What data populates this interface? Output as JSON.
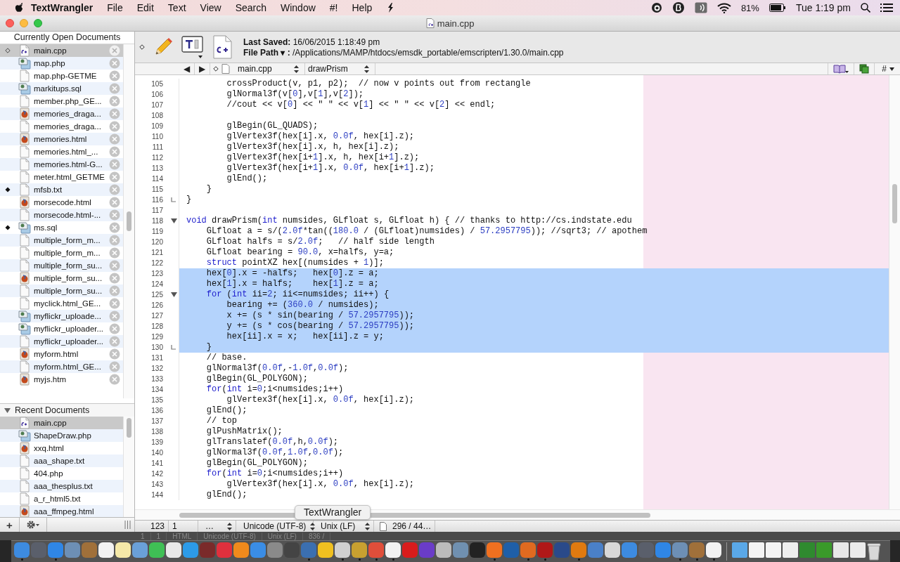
{
  "menu_bar": {
    "app_name": "TextWrangler",
    "menus": [
      "File",
      "Edit",
      "Text",
      "View",
      "Search",
      "Window",
      "#!",
      "Help"
    ],
    "battery": "81%",
    "clock": "Tue 1:19 pm"
  },
  "window": {
    "title": "main.cpp"
  },
  "sidebar": {
    "open_header": "Currently Open Documents",
    "open_documents": [
      {
        "name": "main.cpp",
        "kind": "cpp",
        "active": true,
        "modified": false,
        "selected": true
      },
      {
        "name": "map.php",
        "kind": "script",
        "active": false,
        "modified": false,
        "selected": false
      },
      {
        "name": "map.php-GETME",
        "kind": "blank",
        "active": false,
        "modified": false,
        "selected": false
      },
      {
        "name": "markitups.sql",
        "kind": "script",
        "active": false,
        "modified": false,
        "selected": false
      },
      {
        "name": "member.php_GE...",
        "kind": "blank",
        "active": false,
        "modified": false,
        "selected": false
      },
      {
        "name": "memories_draga...",
        "kind": "html",
        "active": false,
        "modified": false,
        "selected": false
      },
      {
        "name": "memories_draga...",
        "kind": "blank",
        "active": false,
        "modified": false,
        "selected": false
      },
      {
        "name": "memories.html",
        "kind": "html",
        "active": false,
        "modified": false,
        "selected": false
      },
      {
        "name": "memories.html_...",
        "kind": "blank",
        "active": false,
        "modified": false,
        "selected": false
      },
      {
        "name": "memories.html-G...",
        "kind": "blank",
        "active": false,
        "modified": false,
        "selected": false
      },
      {
        "name": "meter.html_GETME",
        "kind": "blank",
        "active": false,
        "modified": false,
        "selected": false
      },
      {
        "name": "mfsb.txt",
        "kind": "blank",
        "active": false,
        "modified": true,
        "selected": false
      },
      {
        "name": "morsecode.html",
        "kind": "html",
        "active": false,
        "modified": false,
        "selected": false
      },
      {
        "name": "morsecode.html-...",
        "kind": "blank",
        "active": false,
        "modified": false,
        "selected": false
      },
      {
        "name": "ms.sql",
        "kind": "script",
        "active": false,
        "modified": true,
        "selected": false
      },
      {
        "name": "multiple_form_m...",
        "kind": "blank",
        "active": false,
        "modified": false,
        "selected": false
      },
      {
        "name": "multiple_form_m...",
        "kind": "blank",
        "active": false,
        "modified": false,
        "selected": false
      },
      {
        "name": "multiple_form_su...",
        "kind": "blank",
        "active": false,
        "modified": false,
        "selected": false
      },
      {
        "name": "multiple_form_su...",
        "kind": "html",
        "active": false,
        "modified": false,
        "selected": false
      },
      {
        "name": "multiple_form_su...",
        "kind": "blank",
        "active": false,
        "modified": false,
        "selected": false
      },
      {
        "name": "myclick.html_GE...",
        "kind": "blank",
        "active": false,
        "modified": false,
        "selected": false
      },
      {
        "name": "myflickr_uploade...",
        "kind": "script",
        "active": false,
        "modified": false,
        "selected": false
      },
      {
        "name": "myflickr_uploader...",
        "kind": "script",
        "active": false,
        "modified": false,
        "selected": false
      },
      {
        "name": "myflickr_uploader...",
        "kind": "blank",
        "active": false,
        "modified": false,
        "selected": false
      },
      {
        "name": "myform.html",
        "kind": "html",
        "active": false,
        "modified": false,
        "selected": false
      },
      {
        "name": "myform.html_GE...",
        "kind": "blank",
        "active": false,
        "modified": false,
        "selected": false
      },
      {
        "name": "myjs.htm",
        "kind": "html",
        "active": false,
        "modified": false,
        "selected": false
      }
    ],
    "recent_header": "Recent Documents",
    "recent_expanded": true,
    "recent_documents": [
      {
        "name": "main.cpp",
        "kind": "cpp",
        "selected": true
      },
      {
        "name": "ShapeDraw.php",
        "kind": "script",
        "selected": false
      },
      {
        "name": "xxq.html",
        "kind": "html",
        "selected": false
      },
      {
        "name": "aaa_shape.txt",
        "kind": "blank",
        "selected": false
      },
      {
        "name": "404.php",
        "kind": "blank",
        "selected": false
      },
      {
        "name": "aaa_thesplus.txt",
        "kind": "blank",
        "selected": false
      },
      {
        "name": "a_r_html5.txt",
        "kind": "blank",
        "selected": false
      },
      {
        "name": "aaa_ffmpeg.html",
        "kind": "html",
        "selected": false
      }
    ],
    "add_button": "+"
  },
  "toolbar": {
    "last_saved_label": "Last Saved:",
    "last_saved": "16/06/2015 1:18:49 pm",
    "file_path_label": "File Path ▾ :",
    "file_path": "/Applications/MAMP/htdocs/emsdk_portable/emscripten/1.30.0/main.cpp"
  },
  "nav_bar": {
    "back": "◀",
    "forward": "▶",
    "document": "main.cpp",
    "function": "drawPrism",
    "counterpart": "#"
  },
  "editor": {
    "lines": [
      {
        "number": "105",
        "code": "        crossProduct(v, p1, p2);  // now v points out from rectangle",
        "kind": "plain",
        "selected": false
      },
      {
        "number": "106",
        "code": "        glNormal3f(v[0],v[1],v[2]);",
        "kind": "plain",
        "selected": false
      },
      {
        "number": "107",
        "code": "        //cout << v[0] << \" \" << v[1] << \" \" << v[2] << endl;",
        "kind": "plain",
        "selected": false
      },
      {
        "number": "108",
        "kind": "plain",
        "selected": false
      },
      {
        "number": "109",
        "code": "        glBegin(GL_QUADS);",
        "kind": "plain",
        "selected": false
      },
      {
        "number": "110",
        "code": "        glVertex3f(hex[i].x, 0.0f, hex[i].z);",
        "kind": "plain",
        "selected": false
      },
      {
        "number": "111",
        "code": "        glVertex3f(hex[i].x, h, hex[i].z);",
        "kind": "plain",
        "selected": false
      },
      {
        "number": "112",
        "code": "        glVertex3f(hex[i+1].x, h, hex[i+1].z);",
        "kind": "plain",
        "selected": false
      },
      {
        "number": "113",
        "code": "        glVertex3f(hex[i+1].x, 0.0f, hex[i+1].z);",
        "kind": "plain",
        "selected": false
      },
      {
        "number": "114",
        "code": "        glEnd();",
        "kind": "plain",
        "selected": false
      },
      {
        "number": "115",
        "code": "    }",
        "kind": "plain",
        "selected": false
      },
      {
        "number": "116",
        "code": "}",
        "kind": "foldend",
        "selected": false
      },
      {
        "number": "117",
        "kind": "plain",
        "selected": false
      },
      {
        "number": "118",
        "code": "void drawPrism(int numsides, GLfloat s, GLfloat h) { // thanks to http://cs.indstate.edu",
        "kind": "foldstart",
        "selected": false
      },
      {
        "number": "119",
        "code": "    GLfloat a = s/(2.0f*tan((180.0 / (GLfloat)numsides) / 57.2957795)); //sqrt3; // apothem",
        "kind": "plain",
        "selected": false
      },
      {
        "number": "120",
        "code": "    GLfloat halfs = s/2.0f;   // half side length",
        "kind": "plain",
        "selected": false
      },
      {
        "number": "121",
        "code": "    GLfloat bearing = 90.0, x=halfs, y=a;",
        "kind": "plain",
        "selected": false
      },
      {
        "number": "122",
        "code": "    struct pointXZ hex[(numsides + 1)];",
        "kind": "plain",
        "selected": false
      },
      {
        "number": "123",
        "code": "    hex[0].x = -halfs;   hex[0].z = a;",
        "kind": "plain",
        "selected": true
      },
      {
        "number": "124",
        "code": "    hex[1].x = halfs;    hex[1].z = a;",
        "kind": "plain",
        "selected": true
      },
      {
        "number": "125",
        "code": "    for (int ii=2; ii<=numsides; ii++) {",
        "kind": "foldstart",
        "selected": true
      },
      {
        "number": "126",
        "code": "        bearing += (360.0 / numsides);",
        "kind": "plain",
        "selected": true
      },
      {
        "number": "127",
        "code": "        x += (s * sin(bearing / 57.2957795));",
        "kind": "plain",
        "selected": true
      },
      {
        "number": "128",
        "code": "        y += (s * cos(bearing / 57.2957795));",
        "kind": "plain",
        "selected": true
      },
      {
        "number": "129",
        "code": "        hex[ii].x = x;   hex[ii].z = y;",
        "kind": "plain",
        "selected": true
      },
      {
        "number": "130",
        "code": "    }",
        "kind": "foldend",
        "selected": true
      },
      {
        "number": "131",
        "code": "    // base.",
        "kind": "plain",
        "selected": false
      },
      {
        "number": "132",
        "code": "    glNormal3f(0.0f,-1.0f,0.0f);",
        "kind": "plain",
        "selected": false
      },
      {
        "number": "133",
        "code": "    glBegin(GL_POLYGON);",
        "kind": "plain",
        "selected": false
      },
      {
        "number": "134",
        "code": "    for(int i=0;i<numsides;i++)",
        "kind": "plain",
        "selected": false
      },
      {
        "number": "135",
        "code": "        glVertex3f(hex[i].x, 0.0f, hex[i].z);",
        "kind": "plain",
        "selected": false
      },
      {
        "number": "136",
        "code": "    glEnd();",
        "kind": "plain",
        "selected": false
      },
      {
        "number": "137",
        "code": "    // top",
        "kind": "plain",
        "selected": false
      },
      {
        "number": "138",
        "code": "    glPushMatrix();",
        "kind": "plain",
        "selected": false
      },
      {
        "number": "139",
        "code": "    glTranslatef(0.0f,h,0.0f);",
        "kind": "plain",
        "selected": false
      },
      {
        "number": "140",
        "code": "    glNormal3f(0.0f,1.0f,0.0f);",
        "kind": "plain",
        "selected": false
      },
      {
        "number": "141",
        "code": "    glBegin(GL_POLYGON);",
        "kind": "plain",
        "selected": false
      },
      {
        "number": "142",
        "code": "    for(int i=0;i<numsides;i++)",
        "kind": "plain",
        "selected": false
      },
      {
        "number": "143",
        "code": "        glVertex3f(hex[i].x, 0.0f, hex[i].z);",
        "kind": "plain",
        "selected": false
      },
      {
        "number": "144",
        "code": "    glEnd();",
        "kind": "plain",
        "selected": false
      }
    ]
  },
  "tooltip": "TextWrangler",
  "status_bar": {
    "line": "123",
    "column": "1",
    "function_menu": "…",
    "encoding": "Unicode (UTF-8)",
    "line_endings": "Unix (LF)",
    "counts": "296 / 44…"
  },
  "background_status_bar": {
    "line": "1",
    "column": "1",
    "language": "HTML",
    "encoding": "Unicode (UTF-8)",
    "line_endings": "Unix (LF)",
    "counts": "836 /"
  },
  "dock": {
    "apps": [
      {
        "running": true
      },
      {
        "running": false
      },
      {
        "running": true
      },
      {
        "running": false
      },
      {
        "running": false
      },
      {
        "running": false
      },
      {
        "running": false
      },
      {
        "running": false
      },
      {
        "running": false
      },
      {
        "running": false
      },
      {
        "running": false
      },
      {
        "running": false
      },
      {
        "running": false
      },
      {
        "running": false
      },
      {
        "running": false
      },
      {
        "running": false
      },
      {
        "running": false
      },
      {
        "running": true
      },
      {
        "running": false
      },
      {
        "running": true
      },
      {
        "running": true
      },
      {
        "running": true
      },
      {
        "running": true
      },
      {
        "running": false
      },
      {
        "running": false
      },
      {
        "running": false
      },
      {
        "running": false
      },
      {
        "running": false
      },
      {
        "running": true
      },
      {
        "running": false
      },
      {
        "running": true
      },
      {
        "running": true
      },
      {
        "running": false
      },
      {
        "running": true
      },
      {
        "running": false
      },
      {
        "running": false
      },
      {
        "running": false
      },
      {
        "running": false
      },
      {
        "running": false
      },
      {
        "running": true
      },
      {
        "running": true
      },
      {
        "running": true
      }
    ]
  }
}
